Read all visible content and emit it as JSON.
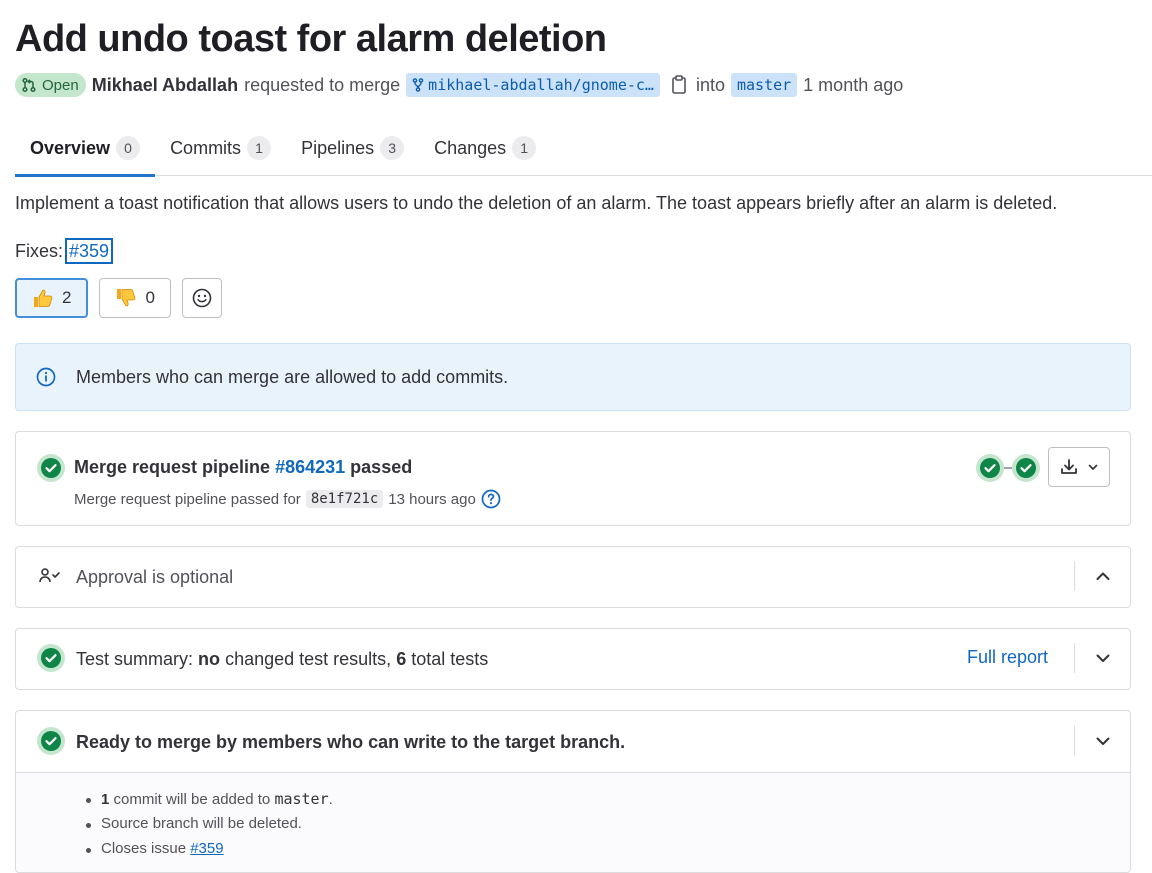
{
  "header": {
    "title": "Add undo toast for alarm deletion",
    "status_badge": "Open",
    "author": "Mikhael Abdallah",
    "action_text": "requested to merge",
    "source_branch": "mikhael-abdallah/gnome-c…",
    "into_text": "into",
    "target_branch": "master",
    "time_ago": "1 month ago"
  },
  "tabs": [
    {
      "label": "Overview",
      "count": "0"
    },
    {
      "label": "Commits",
      "count": "1"
    },
    {
      "label": "Pipelines",
      "count": "3"
    },
    {
      "label": "Changes",
      "count": "1"
    }
  ],
  "description": {
    "text": "Implement a toast notification that allows users to undo the deletion of an alarm. The toast appears briefly after an alarm is deleted.",
    "fixes_label": "Fixes:",
    "fixes_link": "#359"
  },
  "reactions": {
    "thumbs_up": "2",
    "thumbs_down": "0"
  },
  "alert": {
    "text": "Members who can merge are allowed to add commits."
  },
  "pipeline": {
    "title_prefix": "Merge request pipeline",
    "pipeline_id": "#864231",
    "title_suffix": "passed",
    "sub_prefix": "Merge request pipeline passed for",
    "sha": "8e1f721c",
    "time_ago": "13 hours ago"
  },
  "approval": {
    "text": "Approval is optional"
  },
  "test_summary": {
    "label": "Test summary:",
    "no": "no",
    "changed_text": "changed test results,",
    "total": "6",
    "total_text": "total tests",
    "full_report": "Full report"
  },
  "ready": {
    "title": "Ready to merge by members who can write to the target branch.",
    "commit_count": "1",
    "commit_text": "commit will be added to",
    "branch": "master",
    "deleted_text": "Source branch will be deleted.",
    "closes_text": "Closes issue",
    "closes_link": "#359"
  },
  "colors": {
    "success": "#108548",
    "link": "#1068bf",
    "info_bg": "#e9f3fc"
  }
}
